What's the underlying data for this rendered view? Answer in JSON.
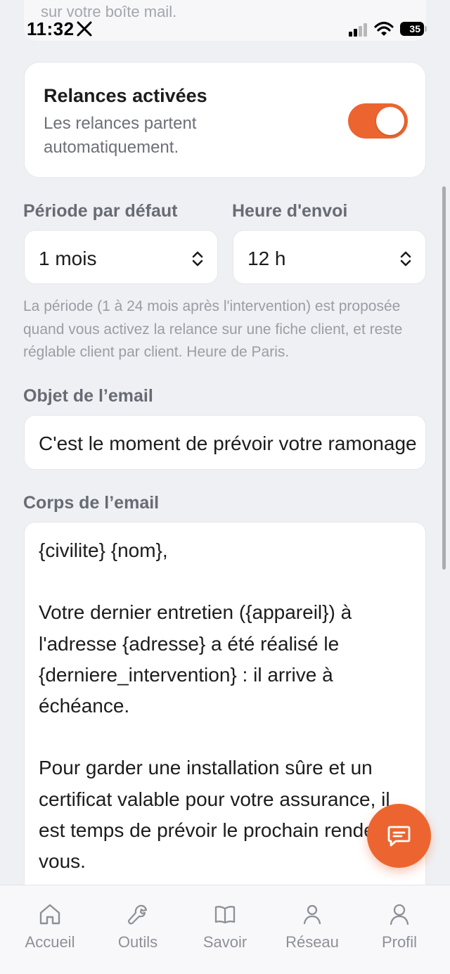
{
  "top_card": {
    "text": "sur votre boîte mail."
  },
  "status_bar": {
    "time": "11:32",
    "battery": "35"
  },
  "reminders": {
    "title": "Relances activées",
    "description": "Les relances partent automatiquement.",
    "enabled": true
  },
  "settings": {
    "period_label": "Période par défaut",
    "period_value": "1 mois",
    "hour_label": "Heure d'envoi",
    "hour_value": "12 h",
    "help_text": "La période (1 à 24 mois après l'intervention) est proposée quand vous activez la relance sur une fiche client, et reste réglable client par client. Heure de Paris."
  },
  "email": {
    "subject_label": "Objet de l’email",
    "subject_value": "C'est le moment de prévoir votre ramonage",
    "body_label": "Corps de l’email",
    "body_value": "{civilite} {nom},\n\nVotre dernier entretien ({appareil}) à l'adresse {adresse} a été réalisé le {derniere_intervention} : il arrive à échéance.\n\nPour garder une installation sûre et un certificat valable pour votre assurance, il est temps de prévoir le prochain rendez-vous."
  },
  "colors": {
    "accent": "#ec6530",
    "background": "#eff0f3"
  },
  "tabs": [
    {
      "label": "Accueil",
      "icon": "home-icon"
    },
    {
      "label": "Outils",
      "icon": "wrench-icon"
    },
    {
      "label": "Savoir",
      "icon": "book-icon"
    },
    {
      "label": "Réseau",
      "icon": "network-icon"
    },
    {
      "label": "Profil",
      "icon": "user-icon"
    }
  ]
}
